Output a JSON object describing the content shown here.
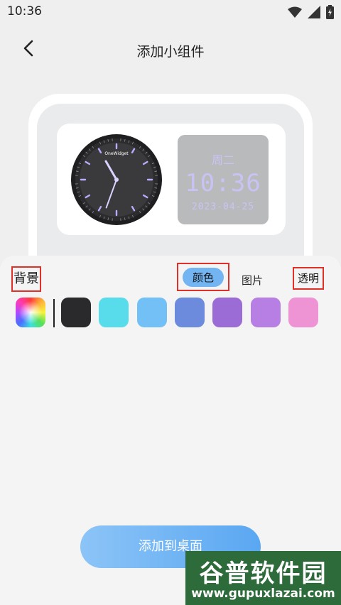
{
  "status_bar": {
    "time": "10:36"
  },
  "header": {
    "title": "添加小组件"
  },
  "preview": {
    "analog_clock": {
      "brand": "OneWidget",
      "hour_hand_angle_deg": 330,
      "minute_hand_angle_deg": 200,
      "accent_color": "#b9acff",
      "face_color": "#2c2c2e"
    },
    "digital_clock": {
      "day": "周二",
      "time": "10:36",
      "date": "2023-04-25",
      "text_color": "#c9c3f5",
      "background_color": "#b9babb"
    }
  },
  "sheet": {
    "section_label": "背景",
    "tabs": {
      "color": "颜色",
      "image": "图片",
      "transparent": "透明"
    },
    "swatches": [
      {
        "name": "black",
        "color": "#2a2a2c"
      },
      {
        "name": "cyan",
        "color": "#58dcec"
      },
      {
        "name": "sky-blue",
        "color": "#72c0f6"
      },
      {
        "name": "blue",
        "color": "#6c8bdc"
      },
      {
        "name": "purple",
        "color": "#9b6bd6"
      },
      {
        "name": "lilac",
        "color": "#b77ee3"
      },
      {
        "name": "pink",
        "color": "#ee93d4"
      }
    ]
  },
  "actions": {
    "add_to_desktop": "添加到桌面"
  },
  "watermark": {
    "name": "谷普软件园",
    "url": "www.gupuxlazai.com"
  }
}
